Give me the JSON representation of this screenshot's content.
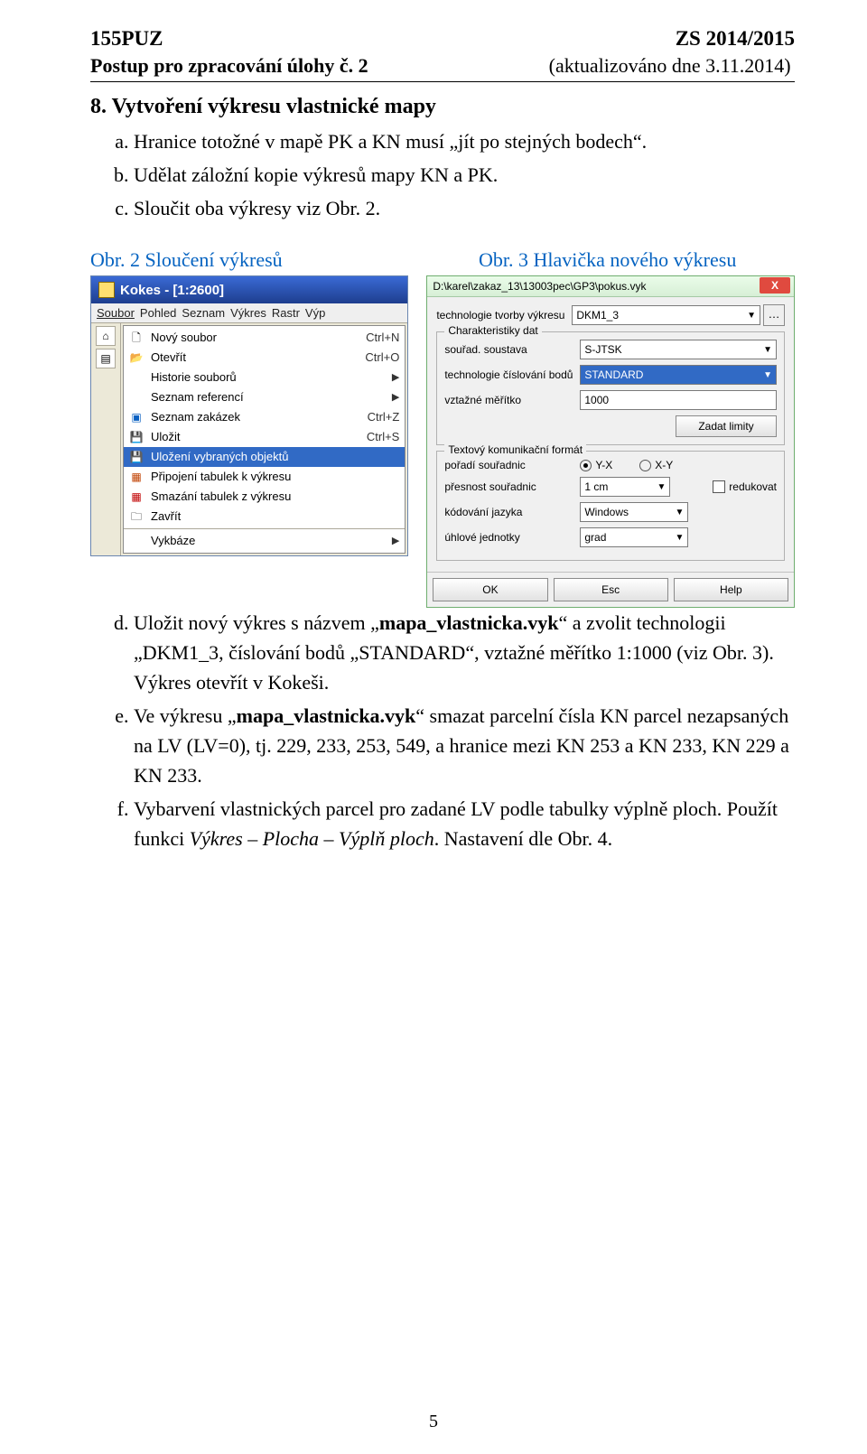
{
  "doc": {
    "header_left": "155PUZ",
    "header_right": "ZS 2014/2015",
    "subhead_bold": "Postup pro zpracování úlohy č. 2",
    "subhead_right": "(aktualizováno dne 3.11.2014)",
    "h1": "8.  Vytvoření výkresu vlastnické mapy",
    "items_a": [
      "Hranice totožné v mapě PK a KN musí „jít po stejných bodech“.",
      "Udělat záložní kopie výkresů mapy KN a PK.",
      "Sloučit oba výkresy viz Obr. 2."
    ],
    "figcap_left": "Obr. 2  Sloučení výkresů",
    "figcap_right": "Obr. 3  Hlavička nového výkresu",
    "items_b_d_pre": "Uložit nový výkres s názvem „",
    "items_b_d_bold": "mapa_vlastnicka.vyk",
    "items_b_d_post": "“ a zvolit technologii „DKM1_3, číslování bodů „STANDARD“, vztažné měřítko 1:1000 (viz Obr. 3). Výkres otevřít v Kokeši.",
    "items_b_e_pre": "Ve výkresu „",
    "items_b_e_bold": "mapa_vlastnicka.vyk",
    "items_b_e_post": "“ smazat parcelní čísla KN parcel nezapsaných na LV (LV=0), tj. 229, 233, 253, 549, a hranice mezi KN 253 a KN 233, KN 229 a KN 233.",
    "items_b_f_pre": "Vybarvení vlastnických parcel pro zadané LV podle tabulky výplně ploch. Použít funkci ",
    "items_b_f_italic": "Výkres – Plocha – Výplň ploch",
    "items_b_f_post": ". Nastavení dle Obr. 4.",
    "pagenum": "5"
  },
  "kokes": {
    "title": "Kokes - [1:2600]",
    "menus": {
      "m1": "Soubor",
      "m2": "Pohled",
      "m3": "Seznam",
      "m4": "Výkres",
      "m5": "Rastr",
      "m6": "Výp"
    },
    "mi": {
      "new": "Nový soubor",
      "new_sc": "Ctrl+N",
      "open": "Otevřít",
      "open_sc": "Ctrl+O",
      "hist": "Historie souborů",
      "refs": "Seznam referencí",
      "orders": "Seznam zakázek",
      "orders_sc": "Ctrl+Z",
      "save": "Uložit",
      "save_sc": "Ctrl+S",
      "save_sel": "Uložení vybraných objektů",
      "attach": "Připojení tabulek k výkresu",
      "detach": "Smazání tabulek z výkresu",
      "close": "Zavřít",
      "vykbaze": "Vykbáze"
    }
  },
  "dlg": {
    "path": "D:\\karel\\zakaz_13\\13003pec\\GP3\\pokus.vyk",
    "tech_label": "technologie tvorby výkresu",
    "tech_val": "DKM1_3",
    "g1": "Charakteristiky dat",
    "coord_label": "souřad. soustava",
    "coord_val": "S-JTSK",
    "num_label": "technologie číslování bodů",
    "num_val": "STANDARD",
    "scale_label": "vztažné měřítko",
    "scale_val": "1000",
    "limits_btn": "Zadat limity",
    "g2": "Textový komunikační formát",
    "order_label": "pořadí souřadnic",
    "order_yx": "Y-X",
    "order_xy": "X-Y",
    "prec_label": "přesnost souřadnic",
    "prec_val": "1 cm",
    "red_label": "redukovat",
    "enc_label": "kódování jazyka",
    "enc_val": "Windows",
    "ang_label": "úhlové jednotky",
    "ang_val": "grad",
    "ok": "OK",
    "esc": "Esc",
    "help": "Help"
  }
}
